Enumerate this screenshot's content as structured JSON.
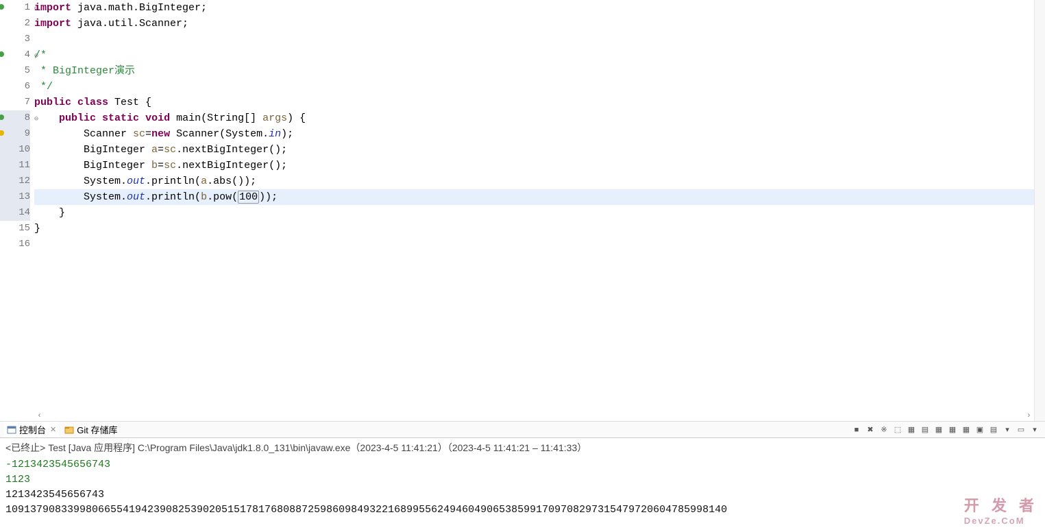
{
  "editor": {
    "lines": [
      {
        "n": "1",
        "marks": [
          "green"
        ],
        "hl": [],
        "segs": [
          {
            "c": "kw",
            "t": "import"
          },
          {
            "t": " java.math.BigInteger;"
          }
        ]
      },
      {
        "n": "2",
        "marks": [],
        "hl": [],
        "segs": [
          {
            "c": "kw",
            "t": "import"
          },
          {
            "t": " java.util.Scanner;"
          }
        ]
      },
      {
        "n": "3",
        "marks": [],
        "hl": [],
        "segs": []
      },
      {
        "n": "4",
        "marks": [
          "green"
        ],
        "hl": [],
        "segs": [
          {
            "c": "cmt",
            "t": "/*"
          }
        ]
      },
      {
        "n": "5",
        "marks": [],
        "hl": [],
        "segs": [
          {
            "c": "cmt",
            "t": " * BigInteger演示"
          }
        ]
      },
      {
        "n": "6",
        "marks": [],
        "hl": [],
        "segs": [
          {
            "c": "cmt",
            "t": " */"
          }
        ]
      },
      {
        "n": "7",
        "marks": [],
        "hl": [],
        "segs": [
          {
            "c": "kw",
            "t": "public"
          },
          {
            "t": " "
          },
          {
            "c": "kw",
            "t": "class"
          },
          {
            "t": " Test {"
          }
        ]
      },
      {
        "n": "8",
        "marks": [
          "green"
        ],
        "hl": [
          "hi"
        ],
        "segs": [
          {
            "t": "    "
          },
          {
            "c": "kw",
            "t": "public"
          },
          {
            "t": " "
          },
          {
            "c": "kw",
            "t": "static"
          },
          {
            "t": " "
          },
          {
            "c": "kw",
            "t": "void"
          },
          {
            "t": " main(String[] "
          },
          {
            "c": "param",
            "t": "args"
          },
          {
            "t": ") {"
          }
        ]
      },
      {
        "n": "9",
        "marks": [
          "warn"
        ],
        "hl": [
          "hi"
        ],
        "segs": [
          {
            "t": "        Scanner "
          },
          {
            "c": "param",
            "t": "sc"
          },
          {
            "t": "="
          },
          {
            "c": "kw",
            "t": "new"
          },
          {
            "t": " Scanner(System."
          },
          {
            "c": "fld",
            "t": "in"
          },
          {
            "t": ");"
          }
        ]
      },
      {
        "n": "10",
        "marks": [],
        "hl": [
          "hi"
        ],
        "segs": [
          {
            "t": "        BigInteger "
          },
          {
            "c": "param",
            "t": "a"
          },
          {
            "t": "="
          },
          {
            "c": "param",
            "t": "sc"
          },
          {
            "t": ".nextBigInteger();"
          }
        ]
      },
      {
        "n": "11",
        "marks": [],
        "hl": [
          "hi"
        ],
        "segs": [
          {
            "t": "        BigInteger "
          },
          {
            "c": "param",
            "t": "b"
          },
          {
            "t": "="
          },
          {
            "c": "param",
            "t": "sc"
          },
          {
            "t": ".nextBigInteger();"
          }
        ]
      },
      {
        "n": "12",
        "marks": [],
        "hl": [
          "hi"
        ],
        "segs": [
          {
            "t": "        System."
          },
          {
            "c": "fld",
            "t": "out"
          },
          {
            "t": ".println("
          },
          {
            "c": "param",
            "t": "a"
          },
          {
            "t": ".abs());"
          }
        ]
      },
      {
        "n": "13",
        "marks": [],
        "hl": [
          "hi",
          "cur"
        ],
        "segs": [
          {
            "t": "        System."
          },
          {
            "c": "fld",
            "t": "out"
          },
          {
            "t": ".println("
          },
          {
            "c": "param",
            "t": "b"
          },
          {
            "t": ".pow("
          },
          {
            "c": "lit",
            "t": "100"
          },
          {
            "t": "));"
          }
        ]
      },
      {
        "n": "14",
        "marks": [],
        "hl": [
          "hi"
        ],
        "segs": [
          {
            "t": "    }"
          }
        ]
      },
      {
        "n": "15",
        "marks": [],
        "hl": [],
        "segs": [
          {
            "t": "}"
          }
        ]
      },
      {
        "n": "16",
        "marks": [],
        "hl": [],
        "segs": []
      }
    ]
  },
  "tabs": {
    "console": "控制台",
    "git": "Git 存储库"
  },
  "toolbar_icons": [
    "■",
    "✖",
    "※",
    "⬚",
    "▦",
    "▤",
    "▦",
    "▦",
    "▦",
    "▣",
    "▤",
    "▾",
    "▭",
    "▾"
  ],
  "status": "<已终止> Test [Java 应用程序] C:\\Program Files\\Java\\jdk1.8.0_131\\bin\\javaw.exe（2023-4-5 11:41:21）（2023-4-5 11:41:21 – 11:41:33）",
  "output": {
    "input1": "-1213423545656743",
    "input2": "1123",
    "result1": "1213423545656743",
    "result2": "109137908339980665541942390825390205151781768088725986098493221689955624946049065385991709708297315479720604785998140"
  },
  "watermark": {
    "main": "开 发 者",
    "sub": "DevZe.CoM"
  }
}
